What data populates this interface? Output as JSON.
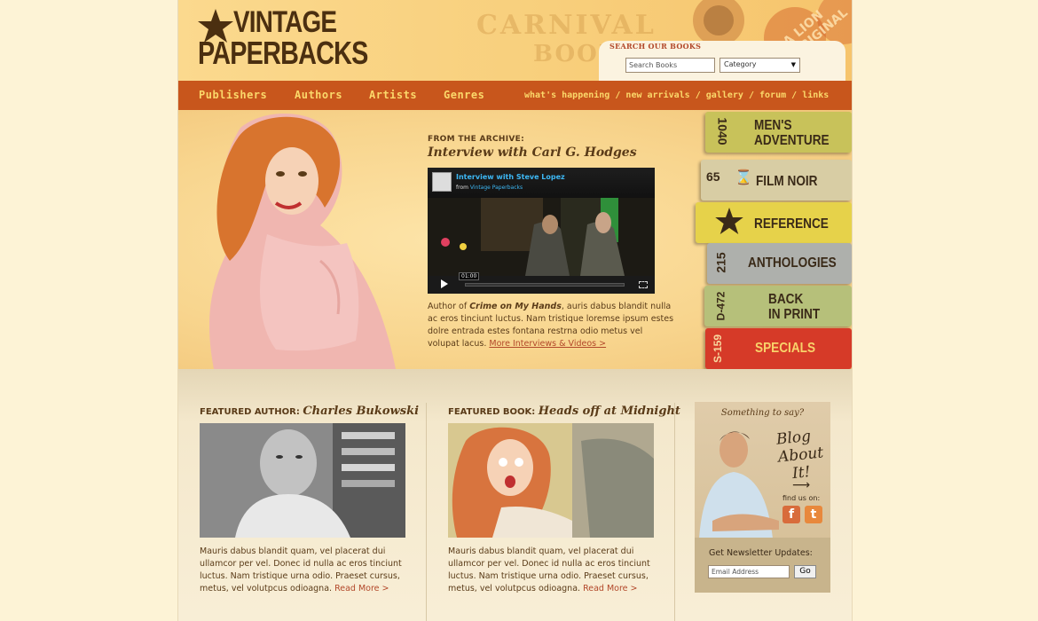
{
  "logo": {
    "line1": "VINTAGE",
    "line2": "PAPERBACKS",
    "icon": "star-icon"
  },
  "header_art": {
    "line1": "CARNIVAL",
    "line2": "BOOKS",
    "badge": "A LION ORIGINAL"
  },
  "search": {
    "label": "SEARCH OUR BOOKS",
    "placeholder": "Search Books",
    "category": "Category"
  },
  "nav": {
    "main": [
      "Publishers",
      "Authors",
      "Artists",
      "Genres"
    ],
    "secondary": [
      "what's happening",
      "new arrivals",
      "gallery",
      "forum",
      "links"
    ],
    "separator": "/"
  },
  "archive": {
    "label": "FROM THE ARCHIVE:",
    "title": "Interview with Carl G. Hodges",
    "video": {
      "title": "Interview with Steve Lopez",
      "from_prefix": "from ",
      "from_source": "Vintage Paperbacks",
      "time": "01:00"
    },
    "text_prefix": "Author of ",
    "book": "Crime on My Hands",
    "text_body": ", auris dabus blandit nulla ac eros tinciunt luctus. Nam tristique loremse ipsum estes dolre entrada estes fontana restrna odio metus vel volupat lacus. ",
    "link": "More Interviews & Videos >"
  },
  "genres": [
    {
      "number": "1040",
      "label_line1": "MEN'S",
      "label_line2": "ADVENTURE",
      "color": "#c8c25a"
    },
    {
      "number": "65",
      "label_line1": "FILM NOIR",
      "label_line2": "",
      "color": "#d8cda4"
    },
    {
      "number": "",
      "label_line1": "REFERENCE",
      "label_line2": "",
      "color": "#e6d24a"
    },
    {
      "number": "215",
      "label_line1": "ANTHOLOGIES",
      "label_line2": "",
      "color": "#aeb0ac"
    },
    {
      "number": "D-472",
      "label_line1": "BACK",
      "label_line2": "IN PRINT",
      "color": "#b6c07a"
    },
    {
      "number": "S-159",
      "label_line1": "SPECIALS",
      "label_line2": "",
      "color": "#d63a28"
    }
  ],
  "featured_author": {
    "label": "FEATURED AUTHOR:",
    "name": "Charles Bukowski",
    "text": "Mauris dabus blandit quam, vel placerat dui ullamcor per vel. Donec id nulla ac eros tinciunt luctus. Nam tristique urna odio. Praeset cursus, metus, vel volutpcus odioagna. ",
    "read_more": "Read More >"
  },
  "featured_book": {
    "label": "FEATURED BOOK:",
    "name": "Heads off at Midnight",
    "text": "Mauris dabus blandit quam, vel placerat dui ullamcor per vel. Donec id nulla ac eros tinciunt luctus. Nam tristique urna odio. Praeset cursus, metus, vel volutpcus odioagna. ",
    "read_more": "Read More >"
  },
  "blog": {
    "question": "Something to say?",
    "line1": "Blog",
    "line2": "About",
    "line3": "It!",
    "find_us": "find us on:",
    "facebook": "f",
    "twitter": "t"
  },
  "newsletter": {
    "label": "Get Newsletter Updates:",
    "placeholder": "Email Address",
    "button": "Go"
  }
}
